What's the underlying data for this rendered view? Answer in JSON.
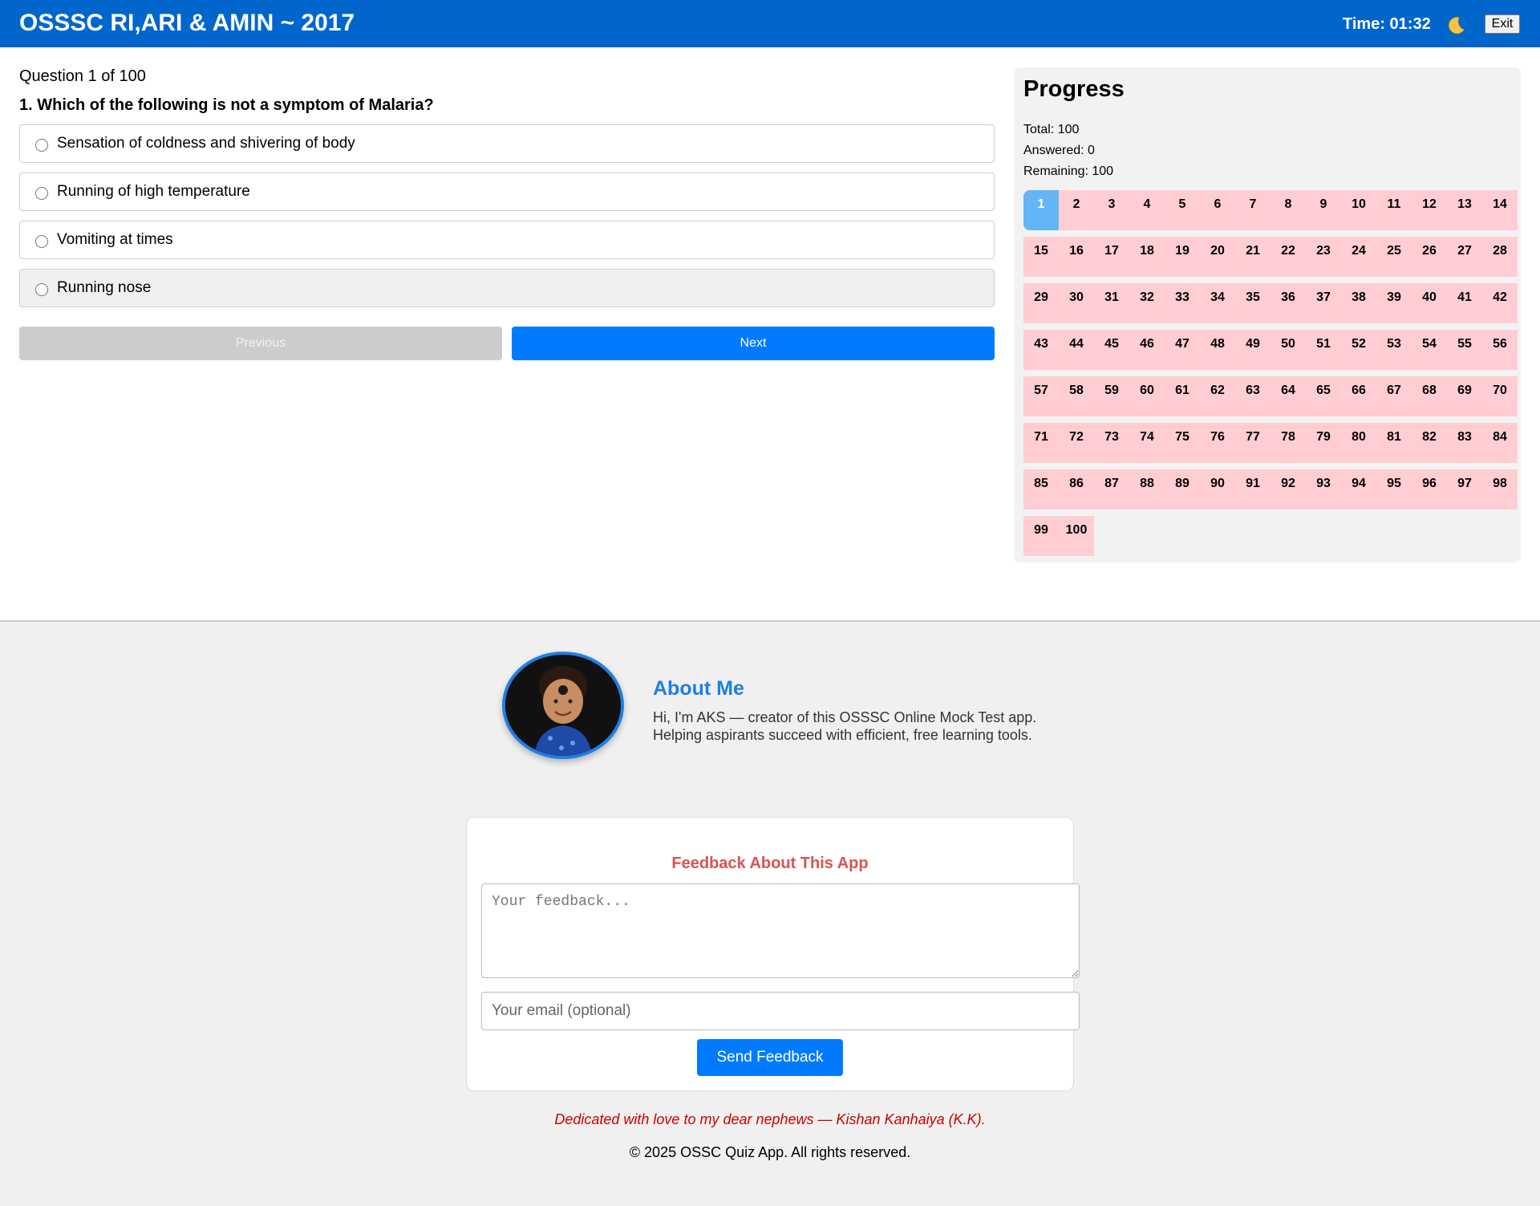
{
  "header": {
    "title": "OSSSC RI,ARI & AMIN ~ 2017",
    "timer": "Time: 01:32",
    "theme_icon": "moon-icon",
    "exit_label": "Exit"
  },
  "question": {
    "counter": "Question 1 of 100",
    "text": "1. Which of the following is not a symptom of Malaria?",
    "options": [
      "Sensation of coldness and shivering of body",
      "Running of high temperature",
      "Vomiting at times",
      "Running nose"
    ],
    "prev_label": "Previous",
    "next_label": "Next"
  },
  "progress": {
    "title": "Progress",
    "total": "Total: 100",
    "answered": "Answered: 0",
    "remaining": "Remaining: 100",
    "current": 1,
    "count": 100
  },
  "about": {
    "title": "About Me",
    "text": "Hi, I'm AKS — creator of this OSSSC Online Mock Test app. Helping aspirants succeed with efficient, free learning tools."
  },
  "feedback": {
    "title": "Feedback About This App",
    "textarea_placeholder": "Your feedback...",
    "email_placeholder": "Your email (optional)",
    "send_label": "Send Feedback"
  },
  "footer": {
    "dedication": "Dedicated with love to my dear nephews — Kishan Kanhaiya (K.K).",
    "copyright": "© 2025 OSSC Quiz App. All rights reserved."
  },
  "colors": {
    "header_bg": "#0066cc",
    "primary_button": "#007bff",
    "current_cell": "#64b5f6",
    "unanswered_cell": "#ffcdd2",
    "feedback_title": "#d9534f",
    "dedication": "#cc0000"
  }
}
